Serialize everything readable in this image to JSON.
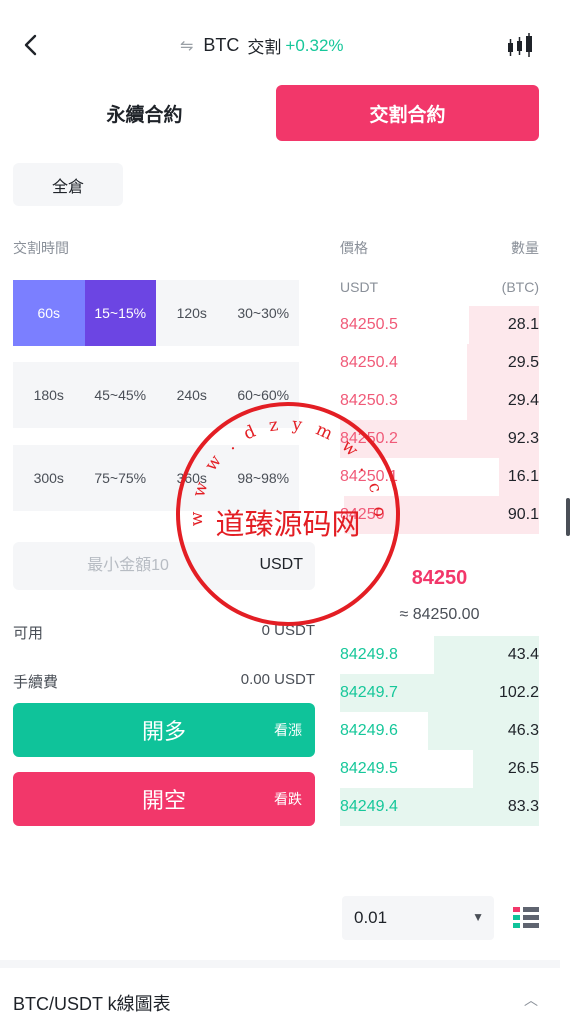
{
  "header": {
    "symbol": "BTC",
    "subtitle": "交割",
    "change": "+0.32%",
    "swap_glyph": "⇋",
    "icons": {
      "back": "chevron-left-icon",
      "kline": "candlestick-icon",
      "swap": "swap-icon"
    }
  },
  "mode_tabs": [
    {
      "label": "永續合約",
      "active": false
    },
    {
      "label": "交割合約",
      "active": true
    }
  ],
  "margin_mode": "全倉",
  "delivery": {
    "label": "交割時間",
    "rows": [
      [
        "60s",
        "15~15%",
        "120s",
        "30~30%"
      ],
      [
        "180s",
        "45~45%",
        "240s",
        "60~60%"
      ],
      [
        "300s",
        "75~75%",
        "360s",
        "98~98%"
      ]
    ],
    "selected_time": "60s",
    "selected_rate": "15~15%"
  },
  "amount": {
    "placeholder": "最小金額10",
    "unit": "USDT"
  },
  "available": {
    "label": "可用",
    "value": "0 USDT"
  },
  "fee": {
    "label": "手續費",
    "value": "0.00 USDT"
  },
  "actions": {
    "long": {
      "label": "開多",
      "hint": "看漲"
    },
    "short": {
      "label": "開空",
      "hint": "看跌"
    }
  },
  "orderbook": {
    "head": {
      "price": "價格",
      "qty": "數量",
      "price_unit": "USDT",
      "qty_unit": "(BTC)"
    },
    "asks": [
      {
        "price": "84250.5",
        "qty": "28.1",
        "depth": 0.35
      },
      {
        "price": "84250.4",
        "qty": "29.5",
        "depth": 0.36
      },
      {
        "price": "84250.3",
        "qty": "29.4",
        "depth": 0.36
      },
      {
        "price": "84250.2",
        "qty": "92.3",
        "depth": 1.0
      },
      {
        "price": "84250.1",
        "qty": "16.1",
        "depth": 0.2
      },
      {
        "price": "84250",
        "qty": "90.1",
        "depth": 0.98
      }
    ],
    "last_price": "84250",
    "last_usd": "≈ 84250.00",
    "bids": [
      {
        "price": "84249.8",
        "qty": "43.4",
        "depth": 0.53
      },
      {
        "price": "84249.7",
        "qty": "102.2",
        "depth": 1.0
      },
      {
        "price": "84249.6",
        "qty": "46.3",
        "depth": 0.56
      },
      {
        "price": "84249.5",
        "qty": "26.5",
        "depth": 0.33
      },
      {
        "price": "84249.4",
        "qty": "83.3",
        "depth": 1.0
      }
    ],
    "precision": "0.01",
    "icons": {
      "layout": "orderbook-layout-icon",
      "dropdown": "caret-down-icon"
    }
  },
  "footer": {
    "title": "BTC/USDT  k線圖表",
    "icon": "chevron-up-icon"
  },
  "watermark": {
    "center": "道臻源码网",
    "ring": "w w w . d z y m w . c o m"
  },
  "colors": {
    "brand": "#f2376a",
    "up": "#0fc39a",
    "time_selected": "#7b7fff",
    "rate_selected": "#6c45e3"
  }
}
